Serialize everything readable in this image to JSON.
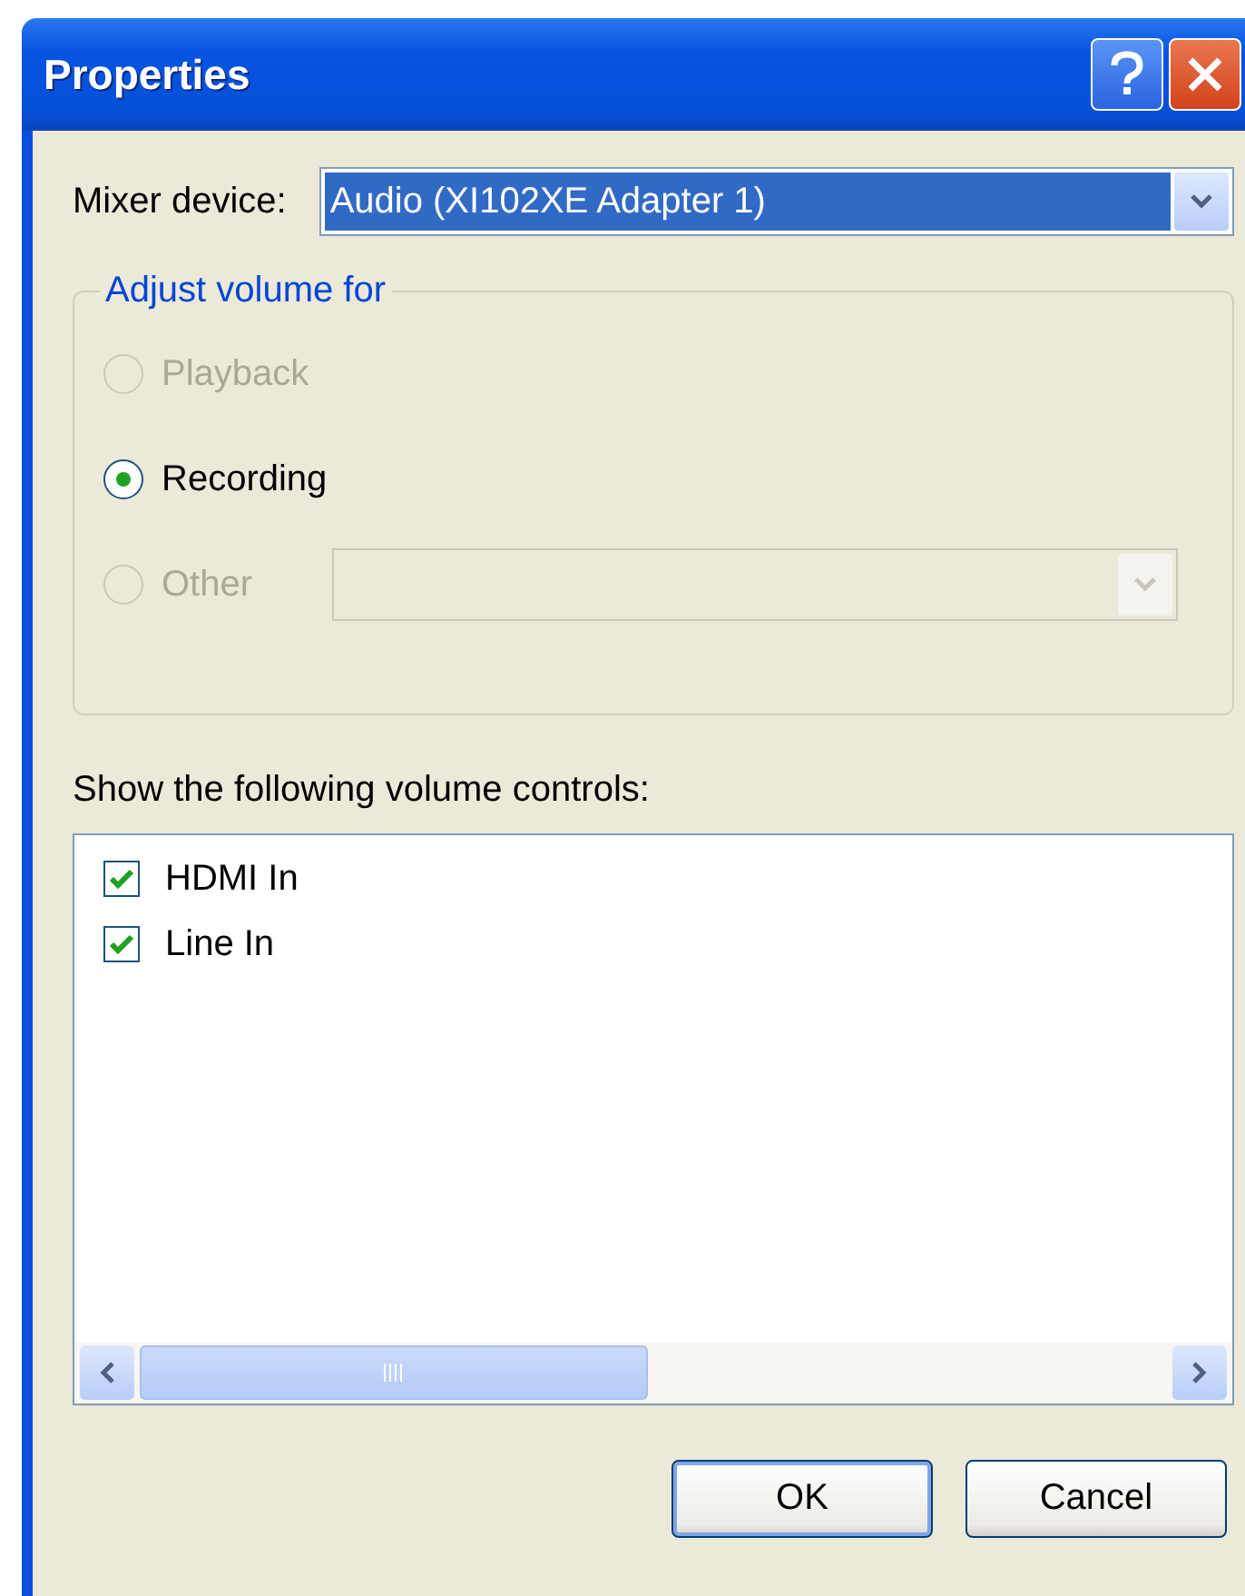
{
  "window": {
    "title": "Properties"
  },
  "mixer_device": {
    "label": "Mixer device:",
    "value": "Audio (XI102XE Adapter 1)"
  },
  "adjust_volume_for": {
    "legend": "Adjust volume for",
    "options": [
      {
        "label": "Playback",
        "kind": "plain",
        "selected": false,
        "disabled": true
      },
      {
        "label": "Recording",
        "kind": "plain",
        "selected": true,
        "disabled": false
      },
      {
        "label": "Other",
        "kind": "combo",
        "selected": false,
        "disabled": true
      }
    ]
  },
  "volume_controls": {
    "label": "Show the following volume controls:",
    "items": [
      {
        "label": "HDMI In",
        "checked": true
      },
      {
        "label": "Line In",
        "checked": true
      }
    ]
  },
  "buttons": [
    {
      "label": "OK",
      "default": true
    },
    {
      "label": "Cancel",
      "default": false
    }
  ]
}
